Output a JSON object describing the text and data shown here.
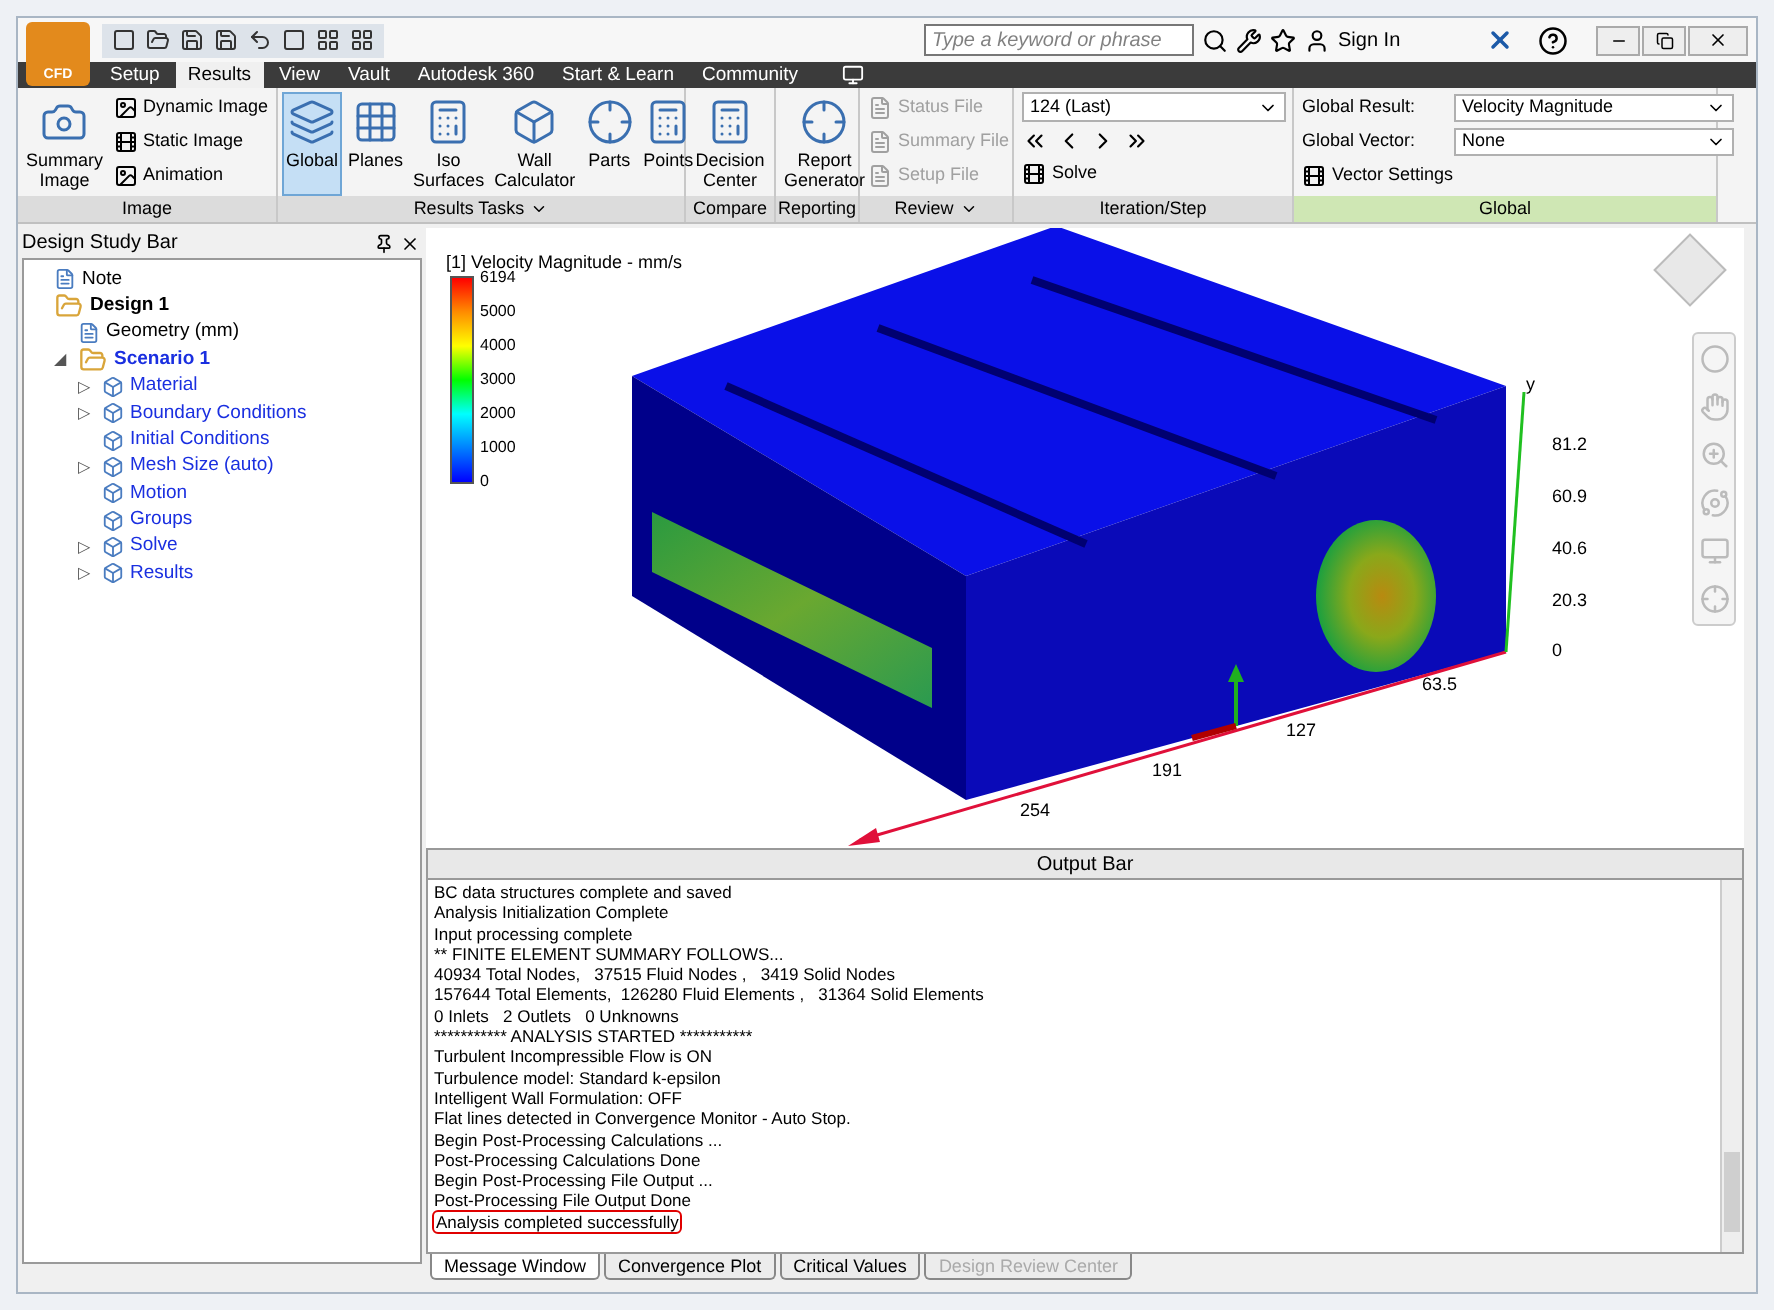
{
  "app_button": {
    "label": "CFD"
  },
  "search": {
    "placeholder": "Type a keyword or phrase"
  },
  "sign_in": "Sign In",
  "tabs": [
    {
      "label": "Setup",
      "selected": false
    },
    {
      "label": "Results",
      "selected": true
    },
    {
      "label": "View",
      "selected": false
    },
    {
      "label": "Vault",
      "selected": false
    },
    {
      "label": "Autodesk 360",
      "selected": false
    },
    {
      "label": "Start & Learn",
      "selected": false
    },
    {
      "label": "Community",
      "selected": false
    }
  ],
  "ribbon": [
    {
      "title": "Image",
      "menu": false,
      "highlighted": false,
      "items": [
        {
          "kind": "large",
          "label": "Summary Image",
          "selected": false
        },
        {
          "kind": "small",
          "label": "Dynamic Image",
          "disabled": false
        },
        {
          "kind": "small",
          "label": "Static Image",
          "disabled": false
        },
        {
          "kind": "small",
          "label": "Animation",
          "disabled": false
        }
      ]
    },
    {
      "title": "Results Tasks",
      "menu": true,
      "highlighted": false,
      "items": [
        {
          "kind": "large",
          "label": "Global",
          "selected": true
        },
        {
          "kind": "large",
          "label": "Planes",
          "selected": false
        },
        {
          "kind": "large",
          "label": "Iso Surfaces",
          "selected": false
        },
        {
          "kind": "large",
          "label": "Wall Calculator",
          "selected": false
        },
        {
          "kind": "large",
          "label": "Parts",
          "selected": false
        },
        {
          "kind": "large",
          "label": "Points",
          "selected": false
        }
      ]
    },
    {
      "title": "Compare",
      "menu": false,
      "highlighted": false,
      "items": [
        {
          "kind": "large",
          "label": "Decision Center",
          "selected": false
        }
      ]
    },
    {
      "title": "Reporting",
      "menu": false,
      "highlighted": false,
      "items": [
        {
          "kind": "large",
          "label": "Report Generator",
          "selected": false
        }
      ]
    },
    {
      "title": "Review",
      "menu": true,
      "highlighted": false,
      "items": [
        {
          "kind": "small",
          "label": "Status File",
          "disabled": true
        },
        {
          "kind": "small",
          "label": "Summary File",
          "disabled": true
        },
        {
          "kind": "small",
          "label": "Setup File",
          "disabled": true
        }
      ]
    },
    {
      "title": "Iteration/Step",
      "menu": false,
      "highlighted": false,
      "items": [
        {
          "kind": "dropdown",
          "value": "124 (Last)"
        },
        {
          "kind": "nav"
        },
        {
          "kind": "small",
          "label": "Solve",
          "disabled": false
        }
      ]
    },
    {
      "title": "Global",
      "menu": false,
      "highlighted": true,
      "items": [
        {
          "kind": "field",
          "label": "Global Result:",
          "value": "Velocity Magnitude"
        },
        {
          "kind": "field",
          "label": "Global Vector:",
          "value": "None"
        },
        {
          "kind": "small",
          "label": "Vector Settings",
          "disabled": false
        }
      ]
    }
  ],
  "design_study_bar": {
    "title": "Design Study Bar",
    "tree": [
      {
        "label": "Note",
        "kind": "item"
      },
      {
        "label": "Design 1",
        "kind": "root",
        "children": [
          {
            "label": "Geometry (mm)",
            "kind": "item"
          },
          {
            "label": "Scenario 1",
            "kind": "scenario",
            "toggle": "◢",
            "children": [
              {
                "label": "Material",
                "kind": "link",
                "toggle": "▷"
              },
              {
                "label": "Boundary Conditions",
                "kind": "link",
                "toggle": "▷"
              },
              {
                "label": "Initial Conditions",
                "kind": "link"
              },
              {
                "label": "Mesh Size (auto)",
                "kind": "link",
                "toggle": "▷"
              },
              {
                "label": "Motion",
                "kind": "link"
              },
              {
                "label": "Groups",
                "kind": "link"
              },
              {
                "label": "Solve",
                "kind": "link",
                "toggle": "▷"
              },
              {
                "label": "Results",
                "kind": "link",
                "toggle": "▷"
              }
            ]
          }
        ]
      }
    ]
  },
  "viewport": {
    "legend": {
      "title": "[1] Velocity Magnitude - mm/s",
      "ticks": [
        "6194",
        "5000",
        "4000",
        "3000",
        "2000",
        "1000",
        "0"
      ]
    },
    "y_axis": {
      "label": "y",
      "ticks": [
        "81.2",
        "60.9",
        "40.6",
        "20.3",
        "0"
      ]
    },
    "x_axis": {
      "ticks": [
        "63.5",
        "127",
        "191",
        "254"
      ]
    }
  },
  "output_bar": {
    "title": "Output Bar",
    "lines": [
      {
        "text": "BC data structures complete and saved",
        "highlighted": false
      },
      {
        "text": "Analysis Initialization Complete",
        "highlighted": false
      },
      {
        "text": "Input processing complete",
        "highlighted": false
      },
      {
        "text": "** FINITE ELEMENT SUMMARY FOLLOWS...",
        "highlighted": false
      },
      {
        "text": "40934 Total Nodes,   37515 Fluid Nodes ,   3419 Solid Nodes",
        "highlighted": false
      },
      {
        "text": "157644 Total Elements,  126280 Fluid Elements ,   31364 Solid Elements",
        "highlighted": false
      },
      {
        "text": "0 Inlets   2 Outlets   0 Unknowns",
        "highlighted": false
      },
      {
        "text": "*********** ANALYSIS STARTED ***********",
        "highlighted": false
      },
      {
        "text": "Turbulent Incompressible Flow is ON",
        "highlighted": false
      },
      {
        "text": "Turbulence model: Standard k-epsilon",
        "highlighted": false
      },
      {
        "text": "Intelligent Wall Formulation: OFF",
        "highlighted": false
      },
      {
        "text": "Flat lines detected in Convergence Monitor - Auto Stop.",
        "highlighted": false
      },
      {
        "text": "Begin Post-Processing Calculations ...",
        "highlighted": false
      },
      {
        "text": "Post-Processing Calculations Done",
        "highlighted": false
      },
      {
        "text": "Begin Post-Processing File Output ...",
        "highlighted": false
      },
      {
        "text": "Post-Processing File Output Done",
        "highlighted": false
      },
      {
        "text": "Analysis completed successfully",
        "highlighted": true
      }
    ],
    "tabs": [
      {
        "label": "Message Window",
        "selected": true,
        "disabled": false
      },
      {
        "label": "Convergence Plot",
        "selected": false,
        "disabled": false
      },
      {
        "label": "Critical Values",
        "selected": false,
        "disabled": false
      },
      {
        "label": "Design Review Center",
        "selected": false,
        "disabled": true
      }
    ]
  }
}
